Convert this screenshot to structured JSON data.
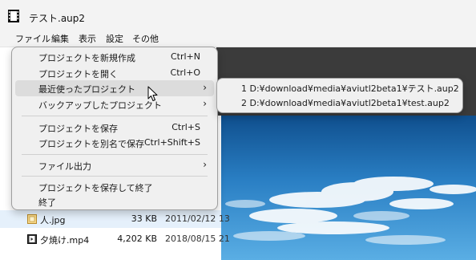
{
  "window": {
    "title": "テスト.aup2"
  },
  "menubar": {
    "items": [
      {
        "label": "ファイル"
      },
      {
        "label": "編集"
      },
      {
        "label": "表示"
      },
      {
        "label": "設定"
      },
      {
        "label": "その他"
      }
    ]
  },
  "file_menu": {
    "items": [
      {
        "label": "プロジェクトを新規作成",
        "shortcut": "Ctrl+N"
      },
      {
        "label": "プロジェクトを開く",
        "shortcut": "Ctrl+O"
      },
      {
        "label": "最近使ったプロジェクト",
        "shortcut": ""
      },
      {
        "label": "バックアップしたプロジェクト",
        "shortcut": ""
      },
      {
        "label": "プロジェクトを保存",
        "shortcut": "Ctrl+S"
      },
      {
        "label": "プロジェクトを別名で保存",
        "shortcut": "Ctrl+Shift+S"
      },
      {
        "label": "ファイル出力",
        "shortcut": ""
      },
      {
        "label": "プロジェクトを保存して終了",
        "shortcut": ""
      },
      {
        "label": "終了",
        "shortcut": ""
      }
    ]
  },
  "recent_submenu": {
    "items": [
      {
        "label": "1 D:¥download¥media¥aviutl2beta1¥テスト.aup2"
      },
      {
        "label": "2 D:¥download¥media¥aviutl2beta1¥test.aup2"
      }
    ]
  },
  "file_list": {
    "rows": [
      {
        "name": "人.jpg",
        "size": "33 KB",
        "date": "2011/02/12 13",
        "selected": true
      },
      {
        "name": "夕焼け.mp4",
        "size": "4,202 KB",
        "date": "2018/08/15 21",
        "selected": false
      }
    ]
  },
  "icons": {
    "submenu_arrow": "›"
  }
}
